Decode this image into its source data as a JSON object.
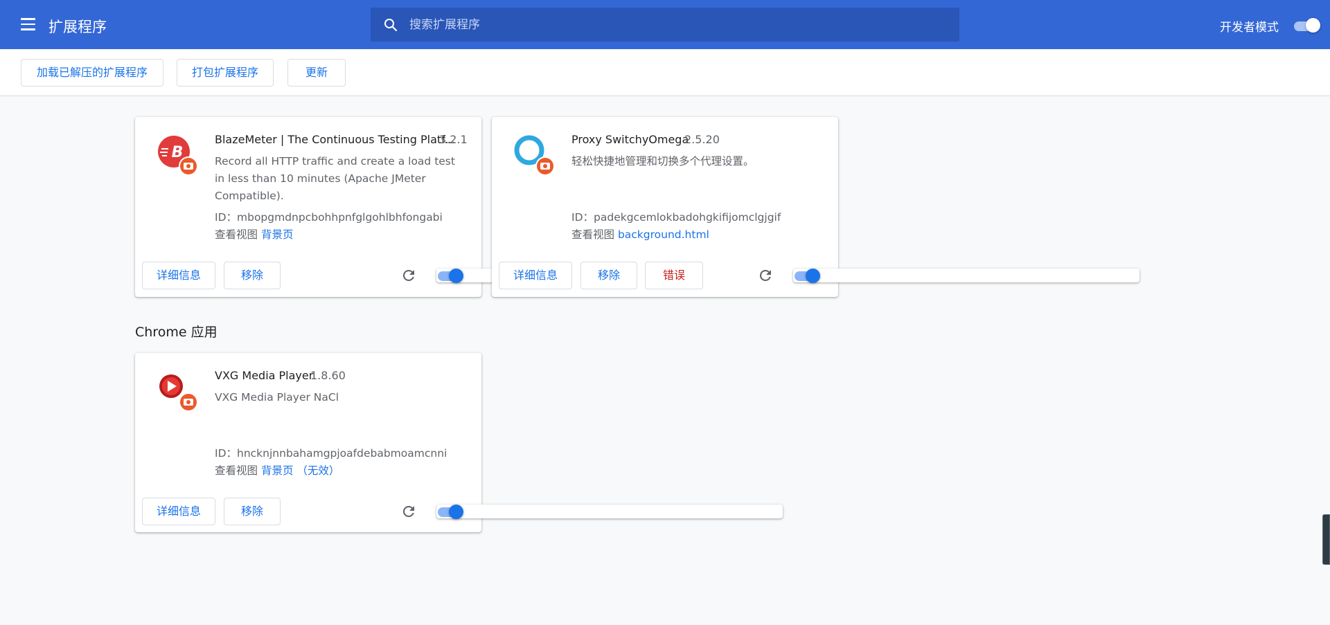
{
  "header": {
    "title": "扩展程序",
    "search_placeholder": "搜索扩展程序",
    "devmode_label": "开发者模式",
    "devmode_enabled": true
  },
  "toolbar": {
    "load_unpacked": "加载已解压的扩展程序",
    "pack": "打包扩展程序",
    "update": "更新"
  },
  "extensions": [
    {
      "name": "BlazeMeter | The Continuous Testing Platf...",
      "version": "3.2.1",
      "description": "Record all HTTP traffic and create a load test in less than 10 minutes (Apache JMeter Compatible).",
      "id_label": "ID：",
      "id": "mbopgmdnpcbohhpnfglgohlbhfongabi",
      "views_label": "查看视图",
      "view_link": "背景页",
      "view_extra": "",
      "details": "详细信息",
      "remove": "移除",
      "error": "",
      "enabled": true,
      "icon": "blazemeter-icon"
    },
    {
      "name": "Proxy SwitchyOmega",
      "version": "2.5.20",
      "description": "轻松快捷地管理和切换多个代理设置。",
      "id_label": "ID：",
      "id": "padekgcemlokbadohgkifijomclgjgif",
      "views_label": "查看视图",
      "view_link": "background.html",
      "view_extra": "",
      "details": "详细信息",
      "remove": "移除",
      "error": "错误",
      "enabled": true,
      "icon": "switchyomega-icon"
    }
  ],
  "apps_section": {
    "title": "Chrome 应用",
    "apps": [
      {
        "name": "VXG Media Player",
        "version": "1.8.60",
        "description": "VXG Media Player NaCl",
        "id_label": "ID：",
        "id": "hncknjnnbahamgpjoafdebabmoamcnni",
        "views_label": "查看视图",
        "view_link": "背景页",
        "view_extra": "（无效）",
        "details": "详细信息",
        "remove": "移除",
        "enabled": true,
        "icon": "vxg-player-icon"
      }
    ]
  },
  "colors": {
    "header_bg": "#3367d6",
    "search_bg": "#2a56b8",
    "accent": "#1a73e8",
    "error": "#c5221f",
    "page_bg": "#f8f9fa"
  }
}
